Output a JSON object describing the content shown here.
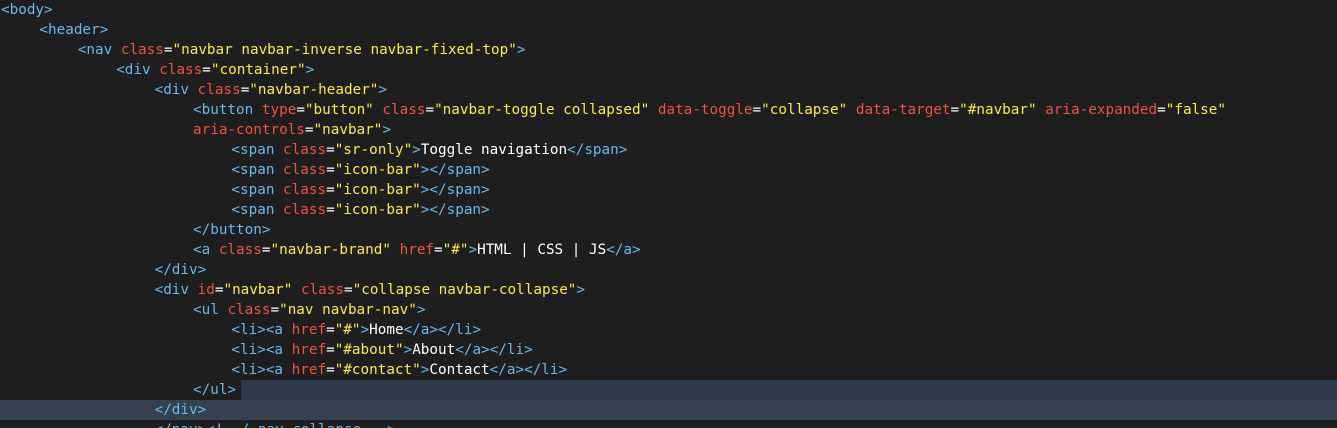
{
  "editor": {
    "colors": {
      "background": "#1e1e1e",
      "tag": "#66b8f0",
      "attribute": "#f0523d",
      "string": "#fce94f",
      "text": "#ffffff",
      "current_line_highlight": "#35414f"
    },
    "lines": [
      {
        "indent": 0,
        "tokens": [
          {
            "t": "tag",
            "v": "<body>"
          }
        ]
      },
      {
        "indent": 1,
        "tokens": [
          {
            "t": "tag",
            "v": "<header>"
          }
        ]
      },
      {
        "indent": 2,
        "tokens": [
          {
            "t": "tag",
            "v": "<nav "
          },
          {
            "t": "attr",
            "v": "class"
          },
          {
            "t": "punct",
            "v": "="
          },
          {
            "t": "str",
            "v": "\"navbar navbar-inverse navbar-fixed-top\""
          },
          {
            "t": "tag",
            "v": ">"
          }
        ]
      },
      {
        "indent": 3,
        "tokens": [
          {
            "t": "tag",
            "v": "<div "
          },
          {
            "t": "attr",
            "v": "class"
          },
          {
            "t": "punct",
            "v": "="
          },
          {
            "t": "str",
            "v": "\"container\""
          },
          {
            "t": "tag",
            "v": ">"
          }
        ]
      },
      {
        "indent": 4,
        "tokens": [
          {
            "t": "tag",
            "v": "<div "
          },
          {
            "t": "attr",
            "v": "class"
          },
          {
            "t": "punct",
            "v": "="
          },
          {
            "t": "str",
            "v": "\"navbar-header\""
          },
          {
            "t": "tag",
            "v": ">"
          }
        ]
      },
      {
        "indent": 5,
        "tokens": [
          {
            "t": "tag",
            "v": "<button "
          },
          {
            "t": "attr",
            "v": "type"
          },
          {
            "t": "punct",
            "v": "="
          },
          {
            "t": "str",
            "v": "\"button\""
          },
          {
            "t": "punct",
            "v": " "
          },
          {
            "t": "attr",
            "v": "class"
          },
          {
            "t": "punct",
            "v": "="
          },
          {
            "t": "str",
            "v": "\"navbar-toggle collapsed\""
          },
          {
            "t": "punct",
            "v": " "
          },
          {
            "t": "attr",
            "v": "data-toggle"
          },
          {
            "t": "punct",
            "v": "="
          },
          {
            "t": "str",
            "v": "\"collapse\""
          },
          {
            "t": "punct",
            "v": " "
          },
          {
            "t": "attr",
            "v": "data-target"
          },
          {
            "t": "punct",
            "v": "="
          },
          {
            "t": "str",
            "v": "\"#navbar\""
          },
          {
            "t": "punct",
            "v": " "
          },
          {
            "t": "attr",
            "v": "aria-expanded"
          },
          {
            "t": "punct",
            "v": "="
          },
          {
            "t": "str",
            "v": "\"false\""
          }
        ]
      },
      {
        "indent": 5,
        "tokens": [
          {
            "t": "attr",
            "v": "aria-controls"
          },
          {
            "t": "punct",
            "v": "="
          },
          {
            "t": "str",
            "v": "\"navbar\""
          },
          {
            "t": "tag",
            "v": ">"
          }
        ]
      },
      {
        "indent": 6,
        "tokens": [
          {
            "t": "tag",
            "v": "<span "
          },
          {
            "t": "attr",
            "v": "class"
          },
          {
            "t": "punct",
            "v": "="
          },
          {
            "t": "str",
            "v": "\"sr-only\""
          },
          {
            "t": "tag",
            "v": ">"
          },
          {
            "t": "text",
            "v": "Toggle navigation"
          },
          {
            "t": "tag",
            "v": "</span>"
          }
        ]
      },
      {
        "indent": 6,
        "tokens": [
          {
            "t": "tag",
            "v": "<span "
          },
          {
            "t": "attr",
            "v": "class"
          },
          {
            "t": "punct",
            "v": "="
          },
          {
            "t": "str",
            "v": "\"icon-bar\""
          },
          {
            "t": "tag",
            "v": "></span>"
          }
        ]
      },
      {
        "indent": 6,
        "tokens": [
          {
            "t": "tag",
            "v": "<span "
          },
          {
            "t": "attr",
            "v": "class"
          },
          {
            "t": "punct",
            "v": "="
          },
          {
            "t": "str",
            "v": "\"icon-bar\""
          },
          {
            "t": "tag",
            "v": "></span>"
          }
        ]
      },
      {
        "indent": 6,
        "tokens": [
          {
            "t": "tag",
            "v": "<span "
          },
          {
            "t": "attr",
            "v": "class"
          },
          {
            "t": "punct",
            "v": "="
          },
          {
            "t": "str",
            "v": "\"icon-bar\""
          },
          {
            "t": "tag",
            "v": "></span>"
          }
        ]
      },
      {
        "indent": 5,
        "tokens": [
          {
            "t": "tag",
            "v": "</button>"
          }
        ]
      },
      {
        "indent": 5,
        "tokens": [
          {
            "t": "tag",
            "v": "<a "
          },
          {
            "t": "attr",
            "v": "class"
          },
          {
            "t": "punct",
            "v": "="
          },
          {
            "t": "str",
            "v": "\"navbar-brand\""
          },
          {
            "t": "punct",
            "v": " "
          },
          {
            "t": "attr",
            "v": "href"
          },
          {
            "t": "punct",
            "v": "="
          },
          {
            "t": "str",
            "v": "\"#\""
          },
          {
            "t": "tag",
            "v": ">"
          },
          {
            "t": "text",
            "v": "HTML | CSS | JS"
          },
          {
            "t": "tag",
            "v": "</a>"
          }
        ]
      },
      {
        "indent": 4,
        "tokens": [
          {
            "t": "tag",
            "v": "</div>"
          }
        ]
      },
      {
        "indent": 4,
        "tokens": [
          {
            "t": "tag",
            "v": "<div "
          },
          {
            "t": "attr",
            "v": "id"
          },
          {
            "t": "punct",
            "v": "="
          },
          {
            "t": "str",
            "v": "\"navbar\""
          },
          {
            "t": "punct",
            "v": " "
          },
          {
            "t": "attr",
            "v": "class"
          },
          {
            "t": "punct",
            "v": "="
          },
          {
            "t": "str",
            "v": "\"collapse navbar-collapse\""
          },
          {
            "t": "tag",
            "v": ">"
          }
        ]
      },
      {
        "indent": 5,
        "tokens": [
          {
            "t": "tag",
            "v": "<ul "
          },
          {
            "t": "attr",
            "v": "class"
          },
          {
            "t": "punct",
            "v": "="
          },
          {
            "t": "str",
            "v": "\"nav navbar-nav\""
          },
          {
            "t": "tag",
            "v": ">"
          }
        ]
      },
      {
        "indent": 6,
        "tokens": [
          {
            "t": "tag",
            "v": "<li><a "
          },
          {
            "t": "attr",
            "v": "href"
          },
          {
            "t": "punct",
            "v": "="
          },
          {
            "t": "str",
            "v": "\"#\""
          },
          {
            "t": "tag",
            "v": ">"
          },
          {
            "t": "text",
            "v": "Home"
          },
          {
            "t": "tag",
            "v": "</a></li>"
          }
        ]
      },
      {
        "indent": 6,
        "tokens": [
          {
            "t": "tag",
            "v": "<li><a "
          },
          {
            "t": "attr",
            "v": "href"
          },
          {
            "t": "punct",
            "v": "="
          },
          {
            "t": "str",
            "v": "\"#about\""
          },
          {
            "t": "tag",
            "v": ">"
          },
          {
            "t": "text",
            "v": "About"
          },
          {
            "t": "tag",
            "v": "</a></li>"
          }
        ]
      },
      {
        "indent": 6,
        "tokens": [
          {
            "t": "tag",
            "v": "<li><a "
          },
          {
            "t": "attr",
            "v": "href"
          },
          {
            "t": "punct",
            "v": "="
          },
          {
            "t": "str",
            "v": "\"#contact\""
          },
          {
            "t": "tag",
            "v": ">"
          },
          {
            "t": "text",
            "v": "Contact"
          },
          {
            "t": "tag",
            "v": "</a></li>"
          }
        ]
      },
      {
        "indent": 5,
        "tokens": [
          {
            "t": "tag",
            "v": "</ul>"
          }
        ]
      },
      {
        "indent": 4,
        "tokens": [
          {
            "t": "tag",
            "v": "</div>"
          }
        ]
      },
      {
        "indent": 4,
        "tokens": [
          {
            "t": "tag",
            "v": "</nav><!--/.nav-collapse -->"
          }
        ]
      }
    ],
    "highlighted_lines": [
      19,
      20
    ]
  }
}
